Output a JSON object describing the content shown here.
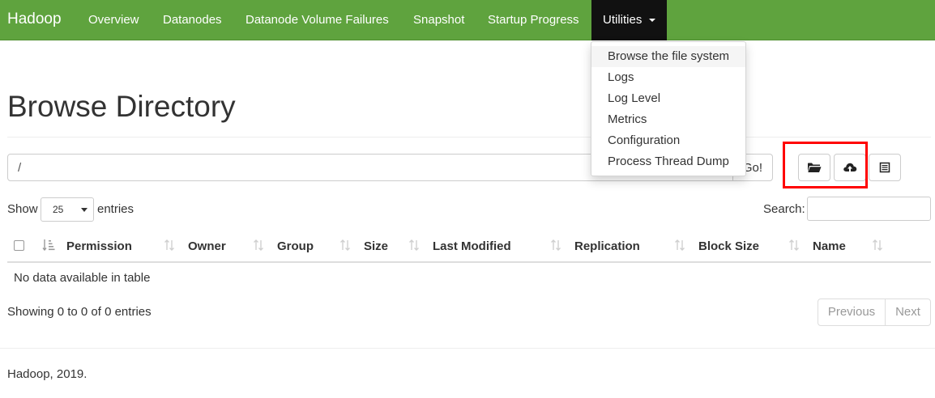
{
  "navbar": {
    "brand": "Hadoop",
    "links": [
      "Overview",
      "Datanodes",
      "Datanode Volume Failures",
      "Snapshot",
      "Startup Progress"
    ],
    "utilities_label": "Utilities",
    "utilities_menu": [
      "Browse the file system",
      "Logs",
      "Log Level",
      "Metrics",
      "Configuration",
      "Process Thread Dump"
    ]
  },
  "page": {
    "title": "Browse Directory"
  },
  "path_bar": {
    "value": "/",
    "go_label": "Go!"
  },
  "toolbar": {
    "icons": [
      "folder-open-icon",
      "cloud-upload-icon",
      "list-icon"
    ]
  },
  "table_controls": {
    "show_label": "Show",
    "entries_value": "25",
    "entries_label": "entries",
    "search_label": "Search:"
  },
  "table": {
    "columns": [
      "Permission",
      "Owner",
      "Group",
      "Size",
      "Last Modified",
      "Replication",
      "Block Size",
      "Name"
    ],
    "empty_message": "No data available in table"
  },
  "pagination": {
    "info": "Showing 0 to 0 of 0 entries",
    "previous": "Previous",
    "next": "Next"
  },
  "footer": {
    "text": "Hadoop, 2019."
  },
  "colors": {
    "navbar": "#5fa33e",
    "active_nav": "#111111",
    "highlight": "#ff0000"
  }
}
